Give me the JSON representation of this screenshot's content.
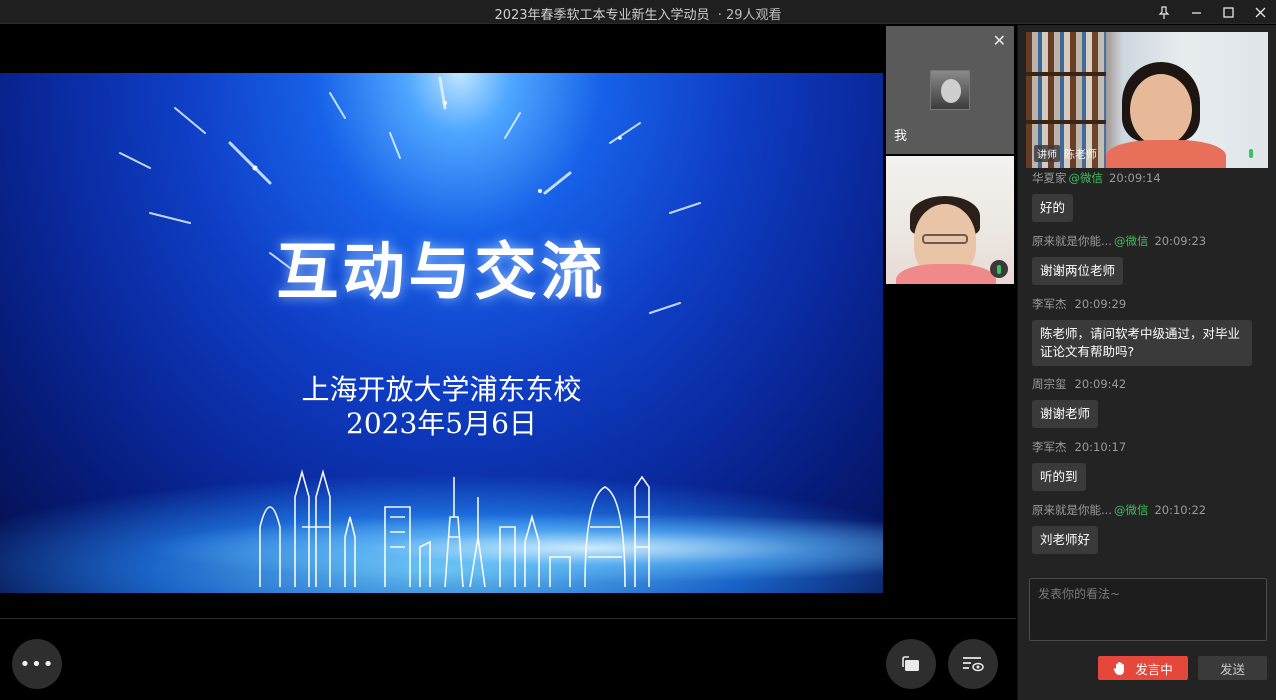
{
  "window": {
    "title": "2023年春季软工本专业新生入学动员",
    "viewers": "· 29人观看"
  },
  "slide": {
    "heading": "互动与交流",
    "school": "上海开放大学浦东东校",
    "date": "2023年5月6日"
  },
  "thumbnails": {
    "me_label": "我"
  },
  "lecturer": {
    "tag": "讲师",
    "name": "陈老师"
  },
  "chat": {
    "messages": [
      {
        "user": "华夏家",
        "source": "@微信",
        "time": "20:09:14",
        "text": "好的"
      },
      {
        "user": "原来就是你能...",
        "source": "@微信",
        "time": "20:09:23",
        "text": "谢谢两位老师"
      },
      {
        "user": "李军杰",
        "source": "",
        "time": "20:09:29",
        "text": "陈老师，请问软考中级通过，对毕业证论文有帮助吗?"
      },
      {
        "user": "周宗玺",
        "source": "",
        "time": "20:09:42",
        "text": "谢谢老师"
      },
      {
        "user": "李军杰",
        "source": "",
        "time": "20:10:17",
        "text": "听的到"
      },
      {
        "user": "原来就是你能...",
        "source": "@微信",
        "time": "20:10:22",
        "text": "刘老师好"
      }
    ],
    "input_placeholder": "发表你的看法~",
    "speaking_label": "发言中",
    "send_label": "发送"
  },
  "icons": {
    "pin": "pin-icon",
    "minimize": "minimize-icon",
    "maximize": "maximize-icon",
    "close": "close-icon"
  },
  "colors": {
    "accent_red": "#e5473b",
    "wechat_green": "#3fbf5f",
    "panel_bg": "#232323"
  }
}
